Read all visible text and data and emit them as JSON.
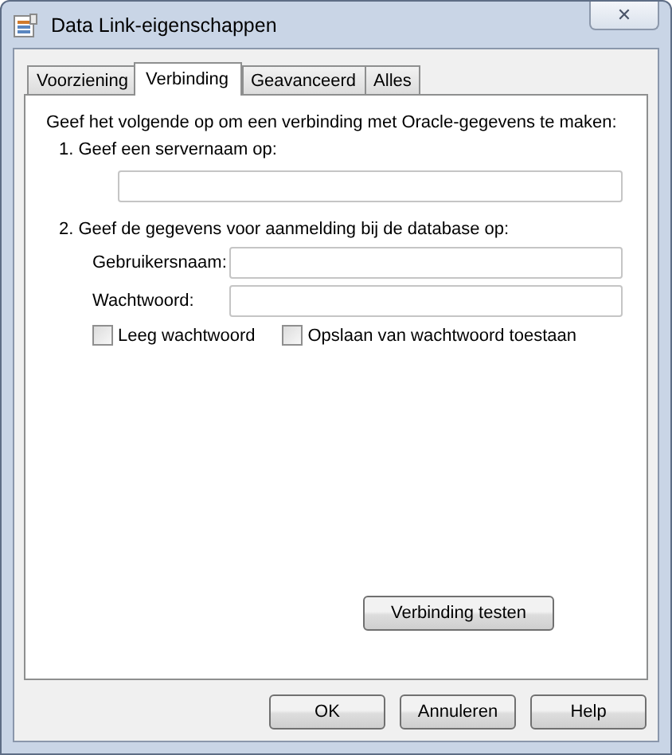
{
  "window": {
    "title": "Data Link-eigenschappen",
    "close": "✕"
  },
  "tabs": [
    {
      "label": "Voorziening",
      "selected": false
    },
    {
      "label": "Verbinding",
      "selected": true
    },
    {
      "label": "Geavanceerd",
      "selected": false
    },
    {
      "label": "Alles",
      "selected": false
    }
  ],
  "intro": "Geef het volgende op om een verbinding met Oracle-gegevens te maken:",
  "step_1": {
    "label": "1. Geef een servernaam op:"
  },
  "step_2": {
    "label": "2. Geef de gegevens voor aanmelding bij de database op:",
    "fields": [
      {
        "label": "Gebruikersnaam:"
      },
      {
        "label": "Wachtwoord:"
      }
    ],
    "checkboxes": [
      {
        "label": "Leeg wachtwoord",
        "checked": false
      },
      {
        "label": "Opslaan van wachtwoord toestaan",
        "checked": false
      }
    ]
  },
  "test_button": "Verbinding testen",
  "buttons": [
    "OK",
    "Annuleren",
    "Help"
  ]
}
